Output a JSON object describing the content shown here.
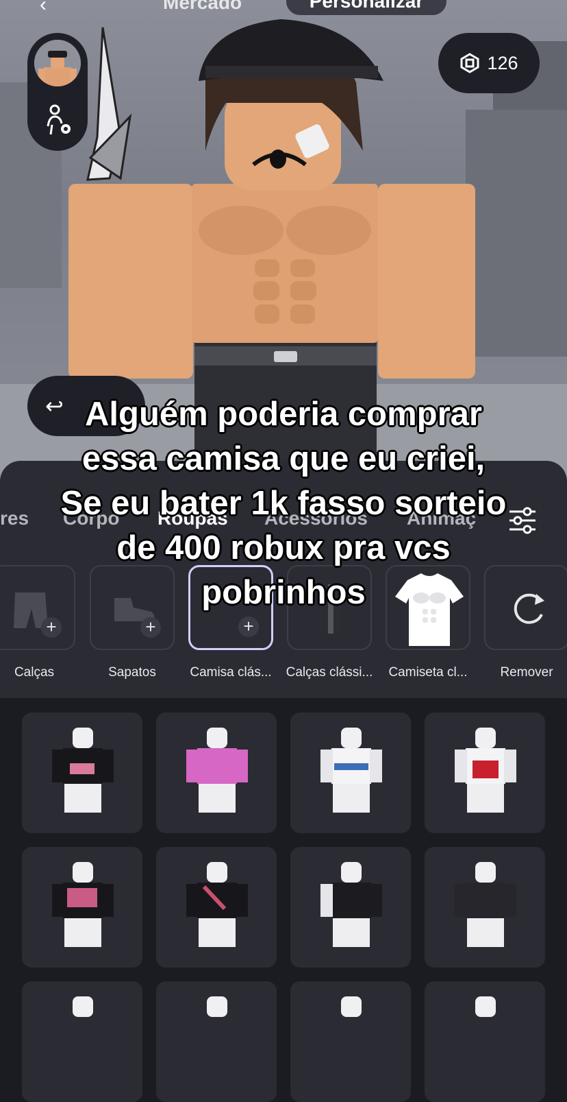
{
  "top_nav": {
    "back_icon": "chevron-left-icon",
    "tabs": [
      {
        "label": "Mercado",
        "active": false
      },
      {
        "label": "Personalizar",
        "active": true
      }
    ]
  },
  "robux": {
    "icon": "robux-icon",
    "amount": "126"
  },
  "overlay_caption": {
    "lines": [
      "Alguém poderia comprar",
      "essa camisa que eu criei,",
      "Se eu bater 1k fasso sorteio",
      "de 400 robux pra vcs",
      "pobrinhos"
    ]
  },
  "categories": {
    "tabs": [
      "res",
      "Corpo",
      "Roupas",
      "Acessórios",
      "Animaç"
    ],
    "active": "Roupas"
  },
  "slots": [
    {
      "label": "Calças"
    },
    {
      "label": "Sapatos"
    },
    {
      "label": "Camisa clás..."
    },
    {
      "label": "Calças clássi..."
    },
    {
      "label": "Camiseta cl..."
    },
    {
      "label": "Remover"
    }
  ],
  "colors": {
    "sheet": "#2a2b33",
    "background": "#1b1c22",
    "pill": "#1f2027",
    "selected_outline": "#cfd0ff",
    "skin": "#e2a679"
  }
}
